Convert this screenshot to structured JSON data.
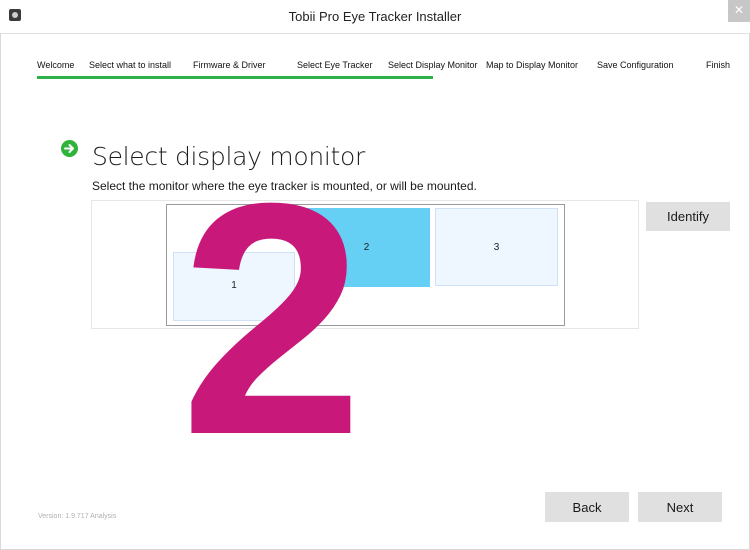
{
  "window": {
    "title": "Tobii Pro Eye Tracker Installer",
    "close_glyph": "✕"
  },
  "steps": [
    {
      "label": "Welcome"
    },
    {
      "label": "Select what to install"
    },
    {
      "label": "Firmware & Driver"
    },
    {
      "label": "Select Eye Tracker"
    },
    {
      "label": "Select Display Monitor"
    },
    {
      "label": "Map to Display Monitor"
    },
    {
      "label": "Save Configuration"
    },
    {
      "label": "Finish"
    }
  ],
  "progress": {
    "completed_steps": 5,
    "total_steps": 8,
    "color": "#2db24a"
  },
  "heading": {
    "title": "Select display monitor",
    "subtitle": "Select the monitor where the eye tracker is mounted, or will be mounted.",
    "icon": "arrow-right-circle-icon"
  },
  "monitors": [
    {
      "label": "1",
      "selected": false
    },
    {
      "label": "2",
      "selected": true
    },
    {
      "label": "3",
      "selected": false
    }
  ],
  "identify_label": "Identify",
  "overlay": {
    "text": "2",
    "color": "#c8197a"
  },
  "footer": {
    "version": "Version: 1.9.717 Analysis",
    "back_label": "Back",
    "next_label": "Next"
  },
  "colors": {
    "selected_monitor": "#66d0f4",
    "monitor_fill": "#eef6ff",
    "accent": "#2fb33a"
  }
}
